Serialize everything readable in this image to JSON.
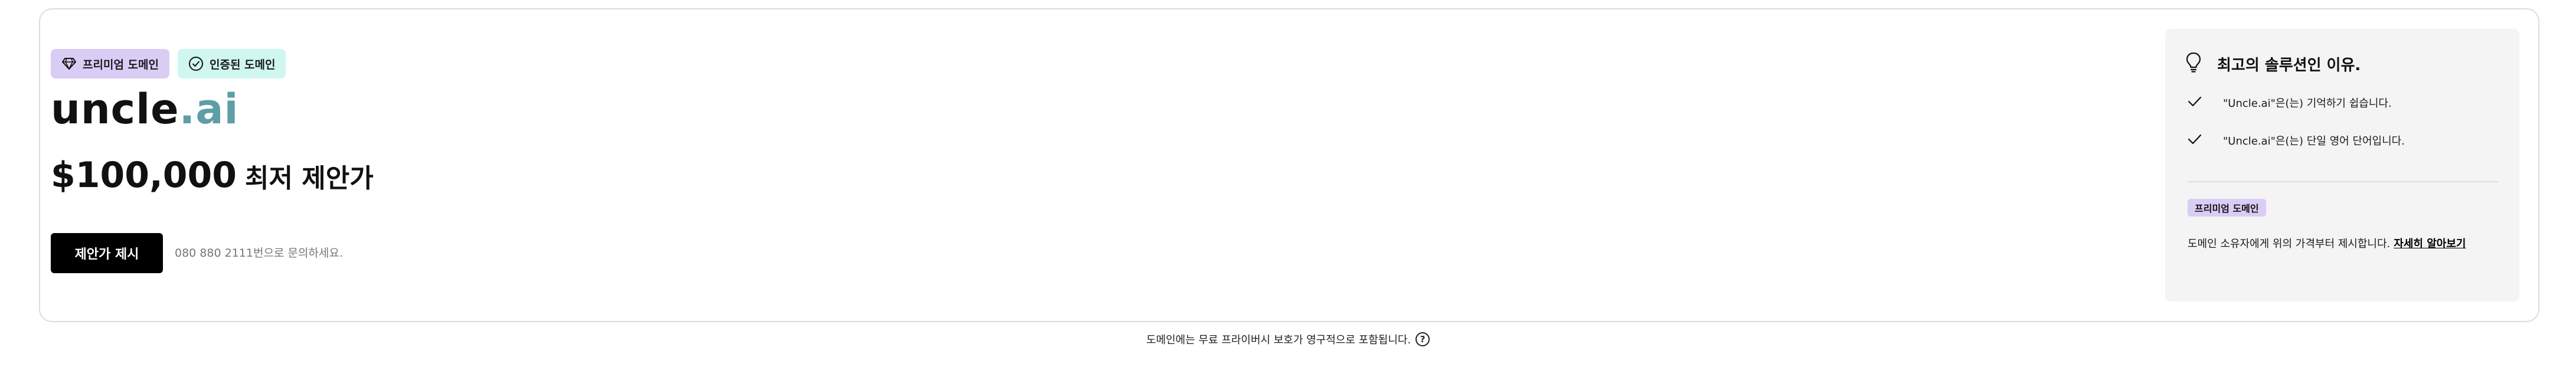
{
  "badges": {
    "premium": {
      "label": "프리미엄 도메인",
      "icon": "diamond-icon",
      "color": "#d9cdf6"
    },
    "verified": {
      "label": "인증된 도메인",
      "icon": "check-circle-icon",
      "color": "#cff6ef"
    }
  },
  "domain": {
    "name": "uncle",
    "tld": ".ai",
    "tld_color": "#5e9ea7"
  },
  "price": {
    "amount": "$100,000",
    "label": "최저 제안가"
  },
  "offer": {
    "button_label": "제안가 제시",
    "phone_note": "080 880 2111번으로 문의하세요."
  },
  "side_panel": {
    "title": "최고의 솔루션인 이유.",
    "title_icon": "lightbulb-icon",
    "reasons": [
      {
        "text": "\"Uncle.ai\"은(는) 기억하기 쉽습니다.",
        "icon": "check-icon"
      },
      {
        "text": "\"Uncle.ai\"은(는) 단일 영어 단어입니다.",
        "icon": "check-icon"
      }
    ],
    "premium_badge": "프리미엄 도메인",
    "premium_desc": "도메인 소유자에게 위의 가격부터 제시합니다.",
    "learn_more": "자세히 알아보기"
  },
  "footer": {
    "note": "도메인에는 무료 프라이버시 보호가 영구적으로 포함됩니다.",
    "help_icon": "question-circle-icon",
    "help_glyph": "?"
  }
}
